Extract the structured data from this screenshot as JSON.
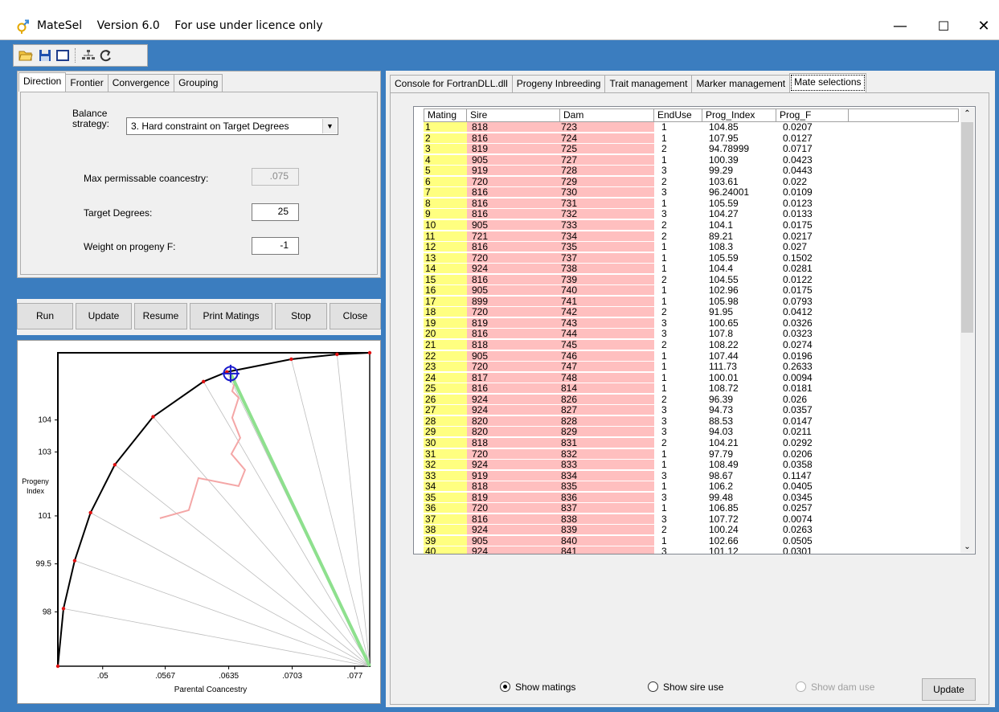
{
  "window": {
    "app_name": "MateSel",
    "version": "Version 6.0",
    "licence": "For use under licence only",
    "minimize": "—",
    "maximize": "☐",
    "close": "✕"
  },
  "toolbar": {
    "icons": [
      "open-folder-icon",
      "save-icon",
      "window-icon",
      "hierarchy-icon",
      "refresh-icon"
    ]
  },
  "left_tabs": [
    "Direction",
    "Frontier",
    "Convergence",
    "Grouping"
  ],
  "direction": {
    "balance_label_1": "Balance",
    "balance_label_2": "strategy:",
    "balance_value": "3. Hard constraint on Target Degrees",
    "max_coancestry_label": "Max permissable coancestry:",
    "max_coancestry_value": ".075",
    "target_degrees_label": "Target Degrees:",
    "target_degrees_value": "25",
    "weight_label": "Weight on progeny F:",
    "weight_value": "-1"
  },
  "actions": {
    "run": "Run",
    "update": "Update",
    "resume": "Resume",
    "print": "Print Matings",
    "stop": "Stop",
    "close": "Close"
  },
  "right_tabs": [
    "Console for FortranDLL.dll",
    "Progeny Inbreeding",
    "Trait management",
    "Marker management",
    "Mate selections"
  ],
  "grid": {
    "headers": [
      "Mating",
      "Sire",
      "Dam",
      "EndUse",
      "Prog_Index",
      "Prog_F"
    ],
    "rows": [
      [
        "1",
        "818",
        "723",
        "1",
        "104.85",
        "0.0207"
      ],
      [
        "2",
        "816",
        "724",
        "1",
        "107.95",
        "0.0127"
      ],
      [
        "3",
        "819",
        "725",
        "2",
        "94.78999",
        "0.0717"
      ],
      [
        "4",
        "905",
        "727",
        "1",
        "100.39",
        "0.0423"
      ],
      [
        "5",
        "919",
        "728",
        "3",
        "99.29",
        "0.0443"
      ],
      [
        "6",
        "720",
        "729",
        "2",
        "103.61",
        "0.022"
      ],
      [
        "7",
        "816",
        "730",
        "3",
        "96.24001",
        "0.0109"
      ],
      [
        "8",
        "816",
        "731",
        "1",
        "105.59",
        "0.0123"
      ],
      [
        "9",
        "816",
        "732",
        "3",
        "104.27",
        "0.0133"
      ],
      [
        "10",
        "905",
        "733",
        "2",
        "104.1",
        "0.0175"
      ],
      [
        "11",
        "721",
        "734",
        "2",
        "89.21",
        "0.0217"
      ],
      [
        "12",
        "816",
        "735",
        "1",
        "108.3",
        "0.027"
      ],
      [
        "13",
        "720",
        "737",
        "1",
        "105.59",
        "0.1502"
      ],
      [
        "14",
        "924",
        "738",
        "1",
        "104.4",
        "0.0281"
      ],
      [
        "15",
        "816",
        "739",
        "2",
        "104.55",
        "0.0122"
      ],
      [
        "16",
        "905",
        "740",
        "1",
        "102.96",
        "0.0175"
      ],
      [
        "17",
        "899",
        "741",
        "1",
        "105.98",
        "0.0793"
      ],
      [
        "18",
        "720",
        "742",
        "2",
        "91.95",
        "0.0412"
      ],
      [
        "19",
        "819",
        "743",
        "3",
        "100.65",
        "0.0326"
      ],
      [
        "20",
        "816",
        "744",
        "3",
        "107.8",
        "0.0323"
      ],
      [
        "21",
        "818",
        "745",
        "2",
        "108.22",
        "0.0274"
      ],
      [
        "22",
        "905",
        "746",
        "1",
        "107.44",
        "0.0196"
      ],
      [
        "23",
        "720",
        "747",
        "1",
        "111.73",
        "0.2633"
      ],
      [
        "24",
        "817",
        "748",
        "1",
        "100.01",
        "0.0094"
      ],
      [
        "25",
        "816",
        "814",
        "1",
        "108.72",
        "0.0181"
      ],
      [
        "26",
        "924",
        "826",
        "2",
        "96.39",
        "0.026"
      ],
      [
        "27",
        "924",
        "827",
        "3",
        "94.73",
        "0.0357"
      ],
      [
        "28",
        "820",
        "828",
        "3",
        "88.53",
        "0.0147"
      ],
      [
        "29",
        "820",
        "829",
        "3",
        "94.03",
        "0.0211"
      ],
      [
        "30",
        "818",
        "831",
        "2",
        "104.21",
        "0.0292"
      ],
      [
        "31",
        "720",
        "832",
        "1",
        "97.79",
        "0.0206"
      ],
      [
        "32",
        "924",
        "833",
        "1",
        "108.49",
        "0.0358"
      ],
      [
        "33",
        "919",
        "834",
        "3",
        "98.67",
        "0.1147"
      ],
      [
        "34",
        "818",
        "835",
        "1",
        "106.2",
        "0.0405"
      ],
      [
        "35",
        "819",
        "836",
        "3",
        "99.48",
        "0.0345"
      ],
      [
        "36",
        "720",
        "837",
        "1",
        "106.85",
        "0.0257"
      ],
      [
        "37",
        "816",
        "838",
        "3",
        "107.72",
        "0.0074"
      ],
      [
        "38",
        "924",
        "839",
        "2",
        "100.24",
        "0.0263"
      ],
      [
        "39",
        "905",
        "840",
        "1",
        "102.66",
        "0.0505"
      ],
      [
        "40",
        "924",
        "841",
        "3",
        "101.12",
        "0.0301"
      ]
    ]
  },
  "bottom": {
    "show_matings": "Show matings",
    "show_sire_use": "Show sire use",
    "show_dam_use": "Show dam use",
    "update": "Update"
  },
  "chart": {
    "ylabel_1": "Progeny",
    "ylabel_2": "Index",
    "xlabel": "Parental Coancestry",
    "y_ticks": [
      "104",
      "103",
      "101",
      "99.5",
      "98"
    ],
    "x_ticks": [
      ".05",
      ".0567",
      ".0635",
      ".0703",
      ".077"
    ]
  },
  "chart_data": {
    "type": "line",
    "xlabel": "Parental Coancestry",
    "ylabel": "Progeny Index",
    "x_ticks": [
      0.05,
      0.0567,
      0.0635,
      0.0703,
      0.077
    ],
    "y_ticks": [
      104,
      103,
      101,
      99.5,
      98
    ],
    "series": [
      {
        "x": [
          0.0452,
          0.0458,
          0.047,
          0.0487,
          0.0513,
          0.0554,
          0.0608,
          0.0633,
          0.0702,
          0.0751,
          0.0786
        ],
        "y": [
          96.3,
          98.1,
          99.6,
          101.1,
          102.6,
          104.1,
          105.2,
          105.5,
          105.9,
          106.05,
          106.1
        ]
      }
    ],
    "selected_point": {
      "x": 0.0637,
      "y": 105.45
    },
    "grid": false
  }
}
